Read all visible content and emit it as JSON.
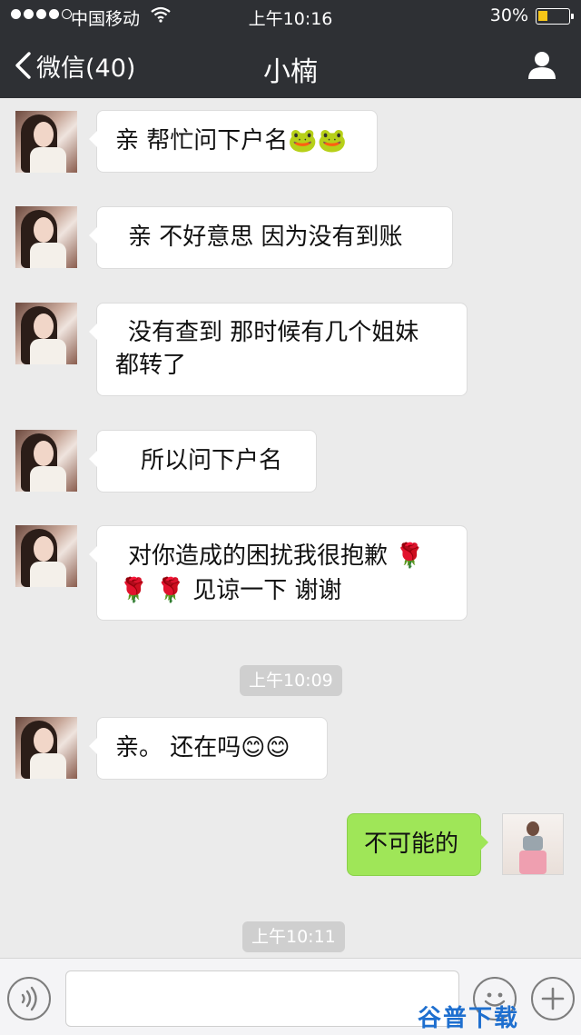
{
  "status_bar": {
    "carrier": "中国移动",
    "time": "上午10:16",
    "battery": "30%"
  },
  "nav": {
    "back_label": "微信(40)",
    "title": "小楠"
  },
  "messages": [
    {
      "side": "left",
      "text": "亲  帮忙问下户名",
      "emojis": "🐸🐸"
    },
    {
      "side": "left",
      "text": "亲  不好意思  因为没有到账"
    },
    {
      "side": "left",
      "line1": "没有查到  那时候有几个姐妹",
      "line2": "都转了"
    },
    {
      "side": "left",
      "text": "所以问下户名"
    },
    {
      "side": "left",
      "line1": "对你造成的困扰我很抱歉 🌹",
      "line2": "🌹 🌹   见谅一下  谢谢"
    },
    {
      "side": "left",
      "text": "亲。  还在吗😊😊"
    },
    {
      "side": "right",
      "text": "不可能的"
    }
  ],
  "timestamps": [
    "上午10:09",
    "上午10:11"
  ],
  "watermark": "谷普下载",
  "colors": {
    "header_bg": "#2e3034",
    "chat_bg": "#ebebeb",
    "my_bubble": "#9fe658",
    "their_bubble": "#ffffff",
    "timestamp_bg": "#cfcfcf",
    "battery_fill": "#f5c518"
  },
  "icons": {
    "back": "chevron-left-icon",
    "profile": "person-icon",
    "voice": "voice-icon",
    "emoji": "smiley-icon",
    "more": "plus-icon"
  }
}
